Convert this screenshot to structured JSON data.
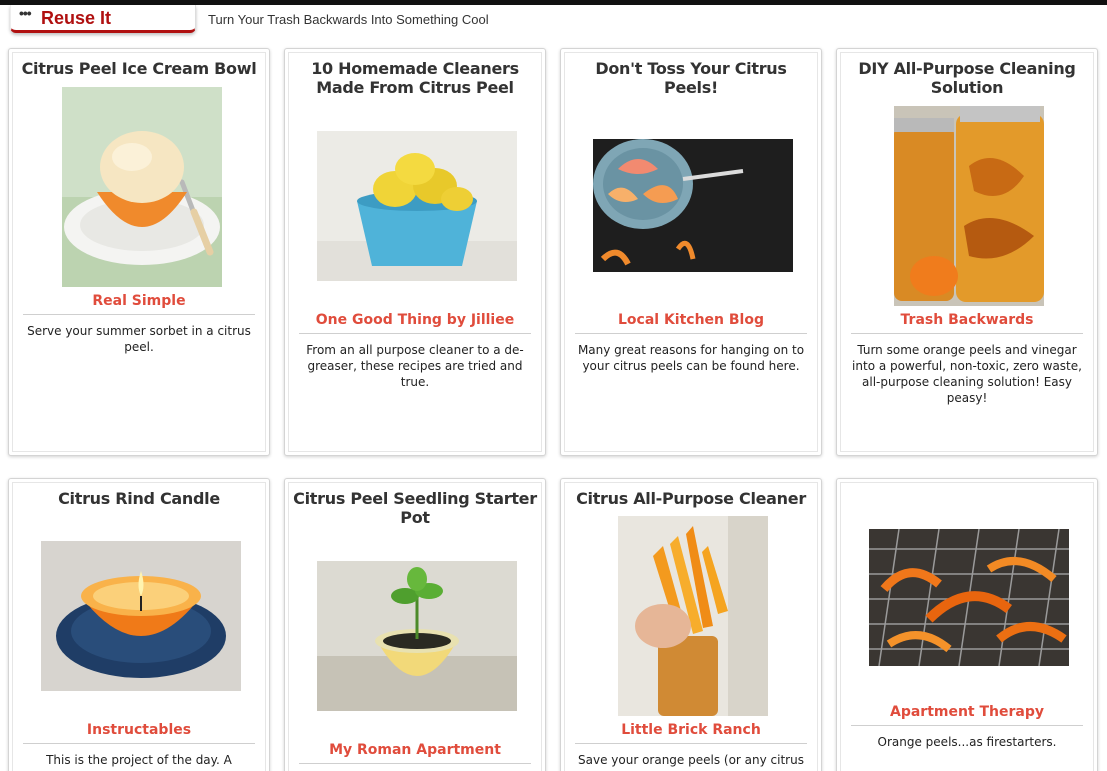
{
  "header": {
    "logo_dots": "•••",
    "logo_text": "Reuse It",
    "tagline": "Turn Your Trash Backwards Into Something Cool"
  },
  "cards": [
    {
      "title": "Citrus Peel Ice Cream Bowl",
      "image": "ice-cream-in-orange-peel",
      "source": "Real Simple",
      "description": "Serve your summer sorbet in a citrus peel."
    },
    {
      "title": "10 Homemade Cleaners Made From Citrus Peel",
      "image": "lemons-in-blue-bowl",
      "source": "One Good Thing by Jilliee",
      "description": "From an all purpose cleaner to a de-greaser, these recipes are tried and true."
    },
    {
      "title": "Don't Toss Your Citrus Peels!",
      "image": "grapefruit-peels-on-plate",
      "source": "Local Kitchen Blog",
      "description": "Many great reasons for hanging on to your citrus peels can be found here."
    },
    {
      "title": "DIY All-Purpose Cleaning Solution",
      "image": "jars-of-orange-peel-vinegar",
      "source": "Trash Backwards",
      "description": "Turn some orange peels and vinegar into a powerful, non-toxic, zero waste, all-purpose cleaning solution! Easy peasy!"
    },
    {
      "title": "Citrus Rind Candle",
      "image": "orange-rind-candle",
      "source": "Instructables",
      "description": "This is the project of the day. A"
    },
    {
      "title": "Citrus Peel Seedling Starter Pot",
      "image": "seedling-in-grapefruit-peel",
      "source": "My Roman Apartment",
      "description": ""
    },
    {
      "title": "Citrus All-Purpose Cleaner",
      "image": "hand-stuffing-peels-into-jar",
      "source": "Little Brick Ranch",
      "description": "Save your orange peels (or any citrus"
    },
    {
      "title": "",
      "image": "orange-peels-on-rack",
      "source": "Apartment Therapy",
      "description": "Orange peels...as firestarters."
    }
  ]
}
